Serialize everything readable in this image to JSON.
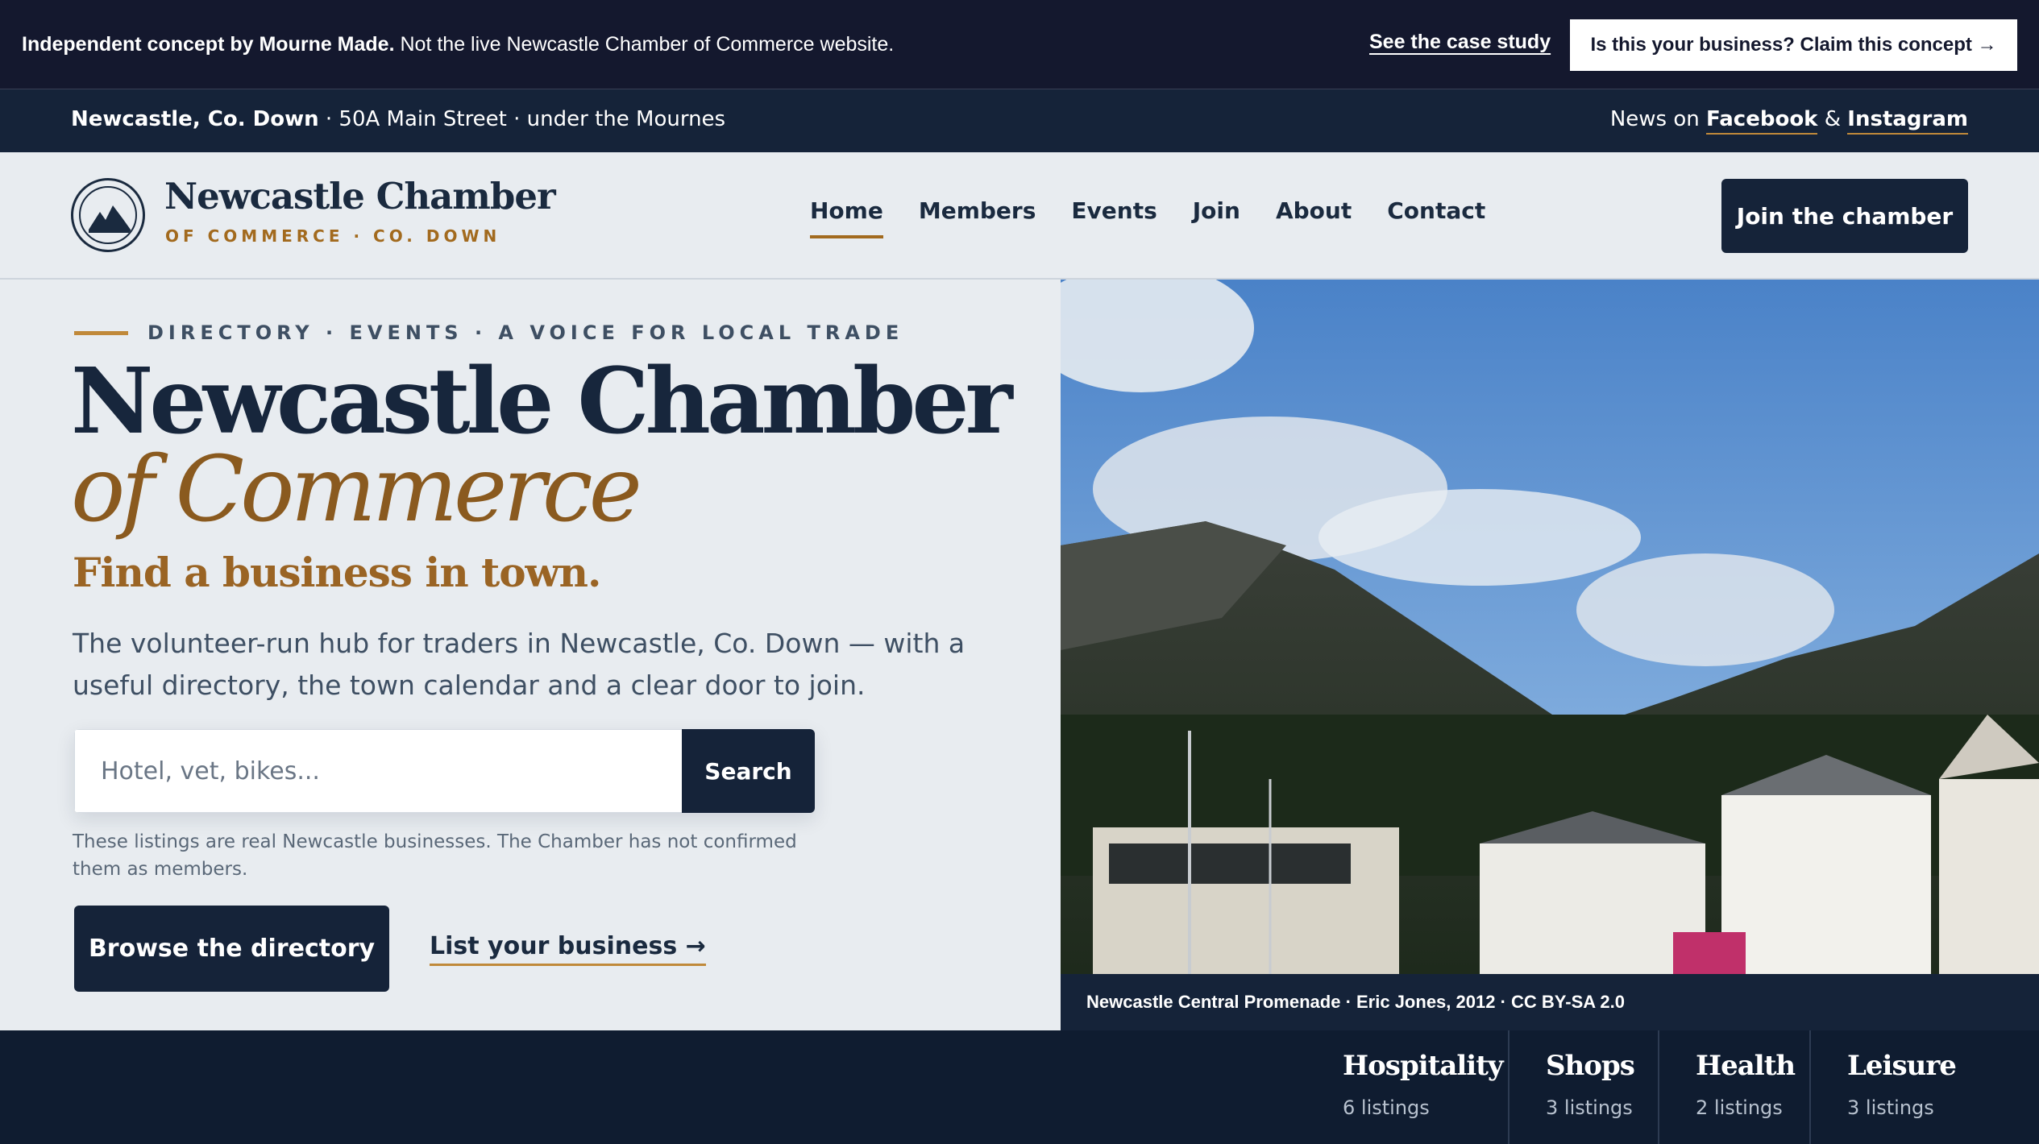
{
  "concept_banner": {
    "lead": "Independent concept by Mourne Made.",
    "text": " Not the live Newcastle Chamber of Commerce website.",
    "case_study_link": "See the case study",
    "claim_button": "Is this your business? Claim this concept →"
  },
  "utility": {
    "town": "Newcastle, Co. Down",
    "address": " · 50A Main Street · under the Mournes",
    "news_prefix": "News on ",
    "facebook": "Facebook",
    "amp": " & ",
    "instagram": "Instagram"
  },
  "header": {
    "brand_name": "Newcastle Chamber",
    "brand_sub": "OF COMMERCE · CO. DOWN",
    "nav": [
      "Home",
      "Members",
      "Events",
      "Join",
      "About",
      "Contact"
    ],
    "active_nav": "Home",
    "cta": "Join the chamber"
  },
  "hero": {
    "eyebrow": "DIRECTORY · EVENTS · A VOICE FOR LOCAL TRADE",
    "title_line1": "Newcastle Chamber",
    "title_line2": "of Commerce",
    "tagline": "Find a business in town.",
    "lede": "The volunteer-run hub for traders in Newcastle, Co. Down — with a useful directory, the town calendar and a clear door to join.",
    "search_placeholder": "Hotel, vet, bikes...",
    "search_button": "Search",
    "note": "These listings are real Newcastle businesses. The Chamber has not confirmed them as members.",
    "browse_button": "Browse the directory",
    "list_link": "List your business →"
  },
  "photo": {
    "caption": "Newcastle Central Promenade · Eric Jones, 2012 · CC BY-SA 2.0"
  },
  "categories": [
    {
      "name": "Hospitality",
      "count": "6 listings"
    },
    {
      "name": "Shops",
      "count": "3 listings"
    },
    {
      "name": "Health",
      "count": "2 listings"
    },
    {
      "name": "Leisure",
      "count": "3 listings"
    }
  ],
  "colors": {
    "navy": "#152339",
    "banner": "#14182e",
    "gold": "#a26a1e",
    "background": "#e8ecf0"
  }
}
